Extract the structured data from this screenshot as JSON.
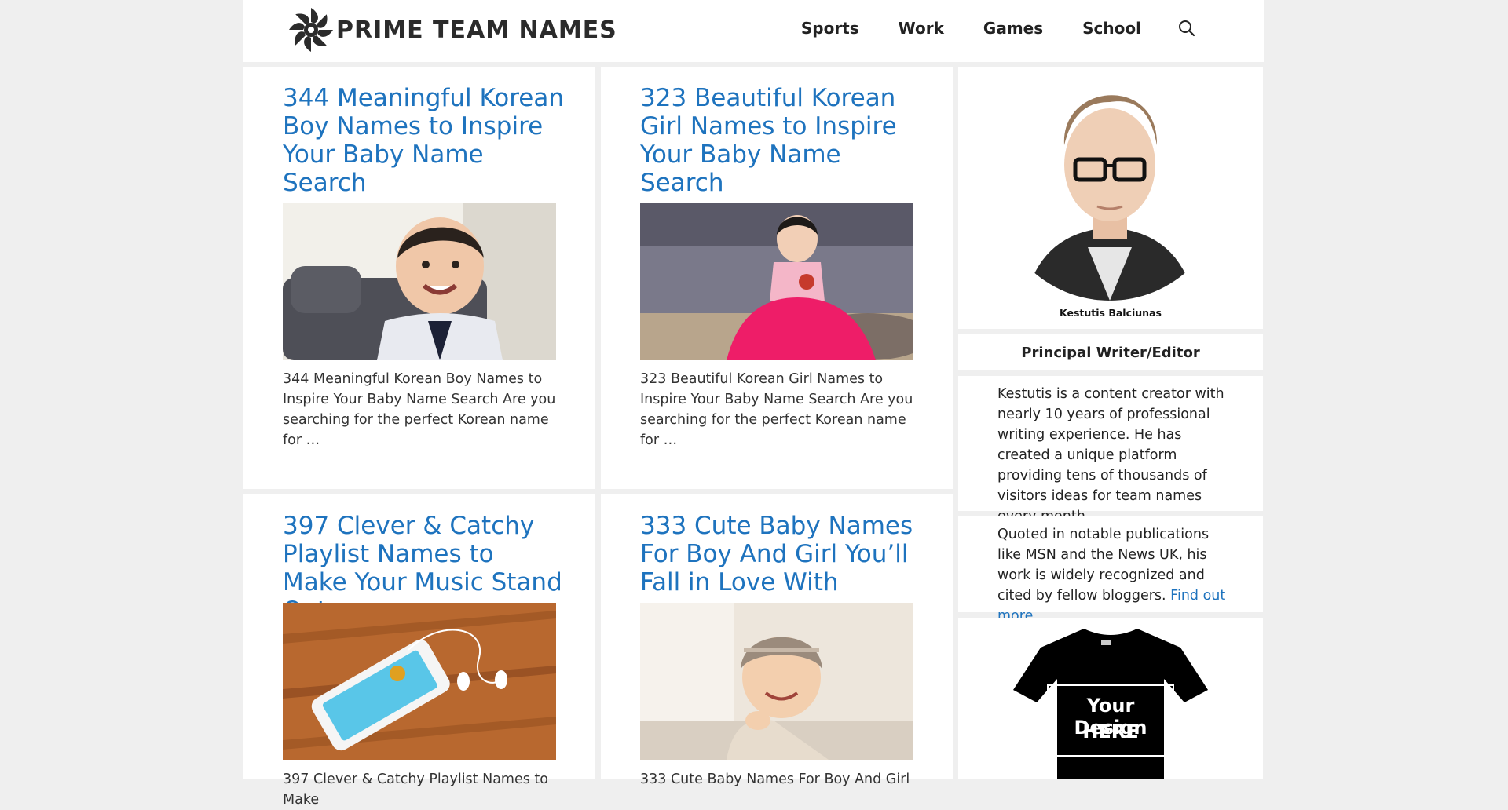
{
  "site": {
    "logo_text": "PRIME TEAM NAMES"
  },
  "nav": {
    "items": [
      "Sports",
      "Work",
      "Games",
      "School"
    ],
    "search_icon": "search-icon"
  },
  "posts": [
    {
      "title": "344 Meaningful Korean Boy Names to Inspire Your Baby Name Search",
      "excerpt": "344 Meaningful Korean Boy Names to Inspire Your Baby Name Search Are you searching for the perfect Korean name for …"
    },
    {
      "title": "323 Beautiful Korean Girl Names to Inspire Your Baby Name Search",
      "excerpt": "323 Beautiful Korean Girl Names to Inspire Your Baby Name Search Are you searching for the perfect Korean name for …"
    },
    {
      "title": "397 Clever & Catchy Playlist Names to Make Your Music Stand Out",
      "excerpt": "397 Clever & Catchy Playlist Names to Make"
    },
    {
      "title": "333 Cute Baby Names For Boy And Girl You’ll Fall in Love With",
      "excerpt": "333 Cute Baby Names For Boy And Girl"
    }
  ],
  "sidebar": {
    "author_name": "Kestutis Balciunas",
    "role": "Principal Writer/Editor",
    "bio1": "Kestutis is a content creator with nearly 10 years of professional writing experience. He has created a unique platform providing tens of thousands of visitors ideas for team names every month.",
    "bio2": "Quoted in notable publications like MSN and the News UK, his work is widely recognized and cited by fellow bloggers.",
    "find_out_more": "Find out more",
    "tshirt_text_line1": "Your Design",
    "tshirt_text_line2": "HERE"
  },
  "colors": {
    "link": "#1e73be",
    "background": "#efefef"
  }
}
